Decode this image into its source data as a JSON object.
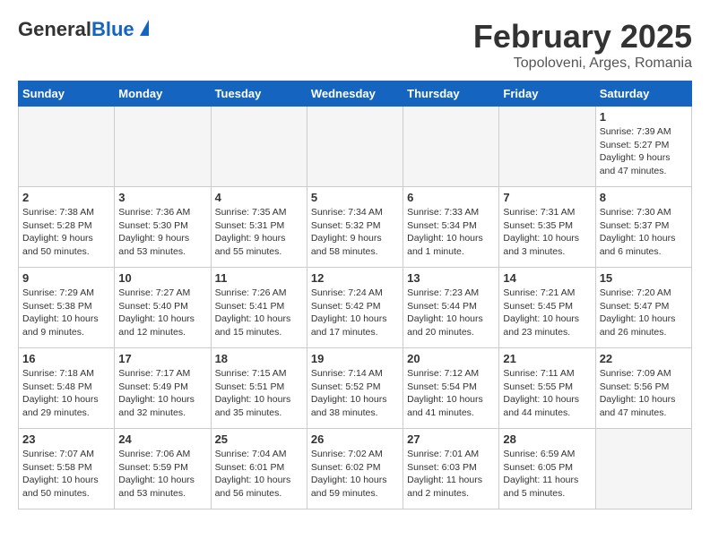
{
  "header": {
    "logo_line1": "General",
    "logo_line2": "Blue",
    "title": "February 2025",
    "subtitle": "Topoloveni, Arges, Romania"
  },
  "weekdays": [
    "Sunday",
    "Monday",
    "Tuesday",
    "Wednesday",
    "Thursday",
    "Friday",
    "Saturday"
  ],
  "weeks": [
    [
      {
        "day": "",
        "info": ""
      },
      {
        "day": "",
        "info": ""
      },
      {
        "day": "",
        "info": ""
      },
      {
        "day": "",
        "info": ""
      },
      {
        "day": "",
        "info": ""
      },
      {
        "day": "",
        "info": ""
      },
      {
        "day": "1",
        "info": "Sunrise: 7:39 AM\nSunset: 5:27 PM\nDaylight: 9 hours\nand 47 minutes."
      }
    ],
    [
      {
        "day": "2",
        "info": "Sunrise: 7:38 AM\nSunset: 5:28 PM\nDaylight: 9 hours\nand 50 minutes."
      },
      {
        "day": "3",
        "info": "Sunrise: 7:36 AM\nSunset: 5:30 PM\nDaylight: 9 hours\nand 53 minutes."
      },
      {
        "day": "4",
        "info": "Sunrise: 7:35 AM\nSunset: 5:31 PM\nDaylight: 9 hours\nand 55 minutes."
      },
      {
        "day": "5",
        "info": "Sunrise: 7:34 AM\nSunset: 5:32 PM\nDaylight: 9 hours\nand 58 minutes."
      },
      {
        "day": "6",
        "info": "Sunrise: 7:33 AM\nSunset: 5:34 PM\nDaylight: 10 hours\nand 1 minute."
      },
      {
        "day": "7",
        "info": "Sunrise: 7:31 AM\nSunset: 5:35 PM\nDaylight: 10 hours\nand 3 minutes."
      },
      {
        "day": "8",
        "info": "Sunrise: 7:30 AM\nSunset: 5:37 PM\nDaylight: 10 hours\nand 6 minutes."
      }
    ],
    [
      {
        "day": "9",
        "info": "Sunrise: 7:29 AM\nSunset: 5:38 PM\nDaylight: 10 hours\nand 9 minutes."
      },
      {
        "day": "10",
        "info": "Sunrise: 7:27 AM\nSunset: 5:40 PM\nDaylight: 10 hours\nand 12 minutes."
      },
      {
        "day": "11",
        "info": "Sunrise: 7:26 AM\nSunset: 5:41 PM\nDaylight: 10 hours\nand 15 minutes."
      },
      {
        "day": "12",
        "info": "Sunrise: 7:24 AM\nSunset: 5:42 PM\nDaylight: 10 hours\nand 17 minutes."
      },
      {
        "day": "13",
        "info": "Sunrise: 7:23 AM\nSunset: 5:44 PM\nDaylight: 10 hours\nand 20 minutes."
      },
      {
        "day": "14",
        "info": "Sunrise: 7:21 AM\nSunset: 5:45 PM\nDaylight: 10 hours\nand 23 minutes."
      },
      {
        "day": "15",
        "info": "Sunrise: 7:20 AM\nSunset: 5:47 PM\nDaylight: 10 hours\nand 26 minutes."
      }
    ],
    [
      {
        "day": "16",
        "info": "Sunrise: 7:18 AM\nSunset: 5:48 PM\nDaylight: 10 hours\nand 29 minutes."
      },
      {
        "day": "17",
        "info": "Sunrise: 7:17 AM\nSunset: 5:49 PM\nDaylight: 10 hours\nand 32 minutes."
      },
      {
        "day": "18",
        "info": "Sunrise: 7:15 AM\nSunset: 5:51 PM\nDaylight: 10 hours\nand 35 minutes."
      },
      {
        "day": "19",
        "info": "Sunrise: 7:14 AM\nSunset: 5:52 PM\nDaylight: 10 hours\nand 38 minutes."
      },
      {
        "day": "20",
        "info": "Sunrise: 7:12 AM\nSunset: 5:54 PM\nDaylight: 10 hours\nand 41 minutes."
      },
      {
        "day": "21",
        "info": "Sunrise: 7:11 AM\nSunset: 5:55 PM\nDaylight: 10 hours\nand 44 minutes."
      },
      {
        "day": "22",
        "info": "Sunrise: 7:09 AM\nSunset: 5:56 PM\nDaylight: 10 hours\nand 47 minutes."
      }
    ],
    [
      {
        "day": "23",
        "info": "Sunrise: 7:07 AM\nSunset: 5:58 PM\nDaylight: 10 hours\nand 50 minutes."
      },
      {
        "day": "24",
        "info": "Sunrise: 7:06 AM\nSunset: 5:59 PM\nDaylight: 10 hours\nand 53 minutes."
      },
      {
        "day": "25",
        "info": "Sunrise: 7:04 AM\nSunset: 6:01 PM\nDaylight: 10 hours\nand 56 minutes."
      },
      {
        "day": "26",
        "info": "Sunrise: 7:02 AM\nSunset: 6:02 PM\nDaylight: 10 hours\nand 59 minutes."
      },
      {
        "day": "27",
        "info": "Sunrise: 7:01 AM\nSunset: 6:03 PM\nDaylight: 11 hours\nand 2 minutes."
      },
      {
        "day": "28",
        "info": "Sunrise: 6:59 AM\nSunset: 6:05 PM\nDaylight: 11 hours\nand 5 minutes."
      },
      {
        "day": "",
        "info": ""
      }
    ]
  ]
}
